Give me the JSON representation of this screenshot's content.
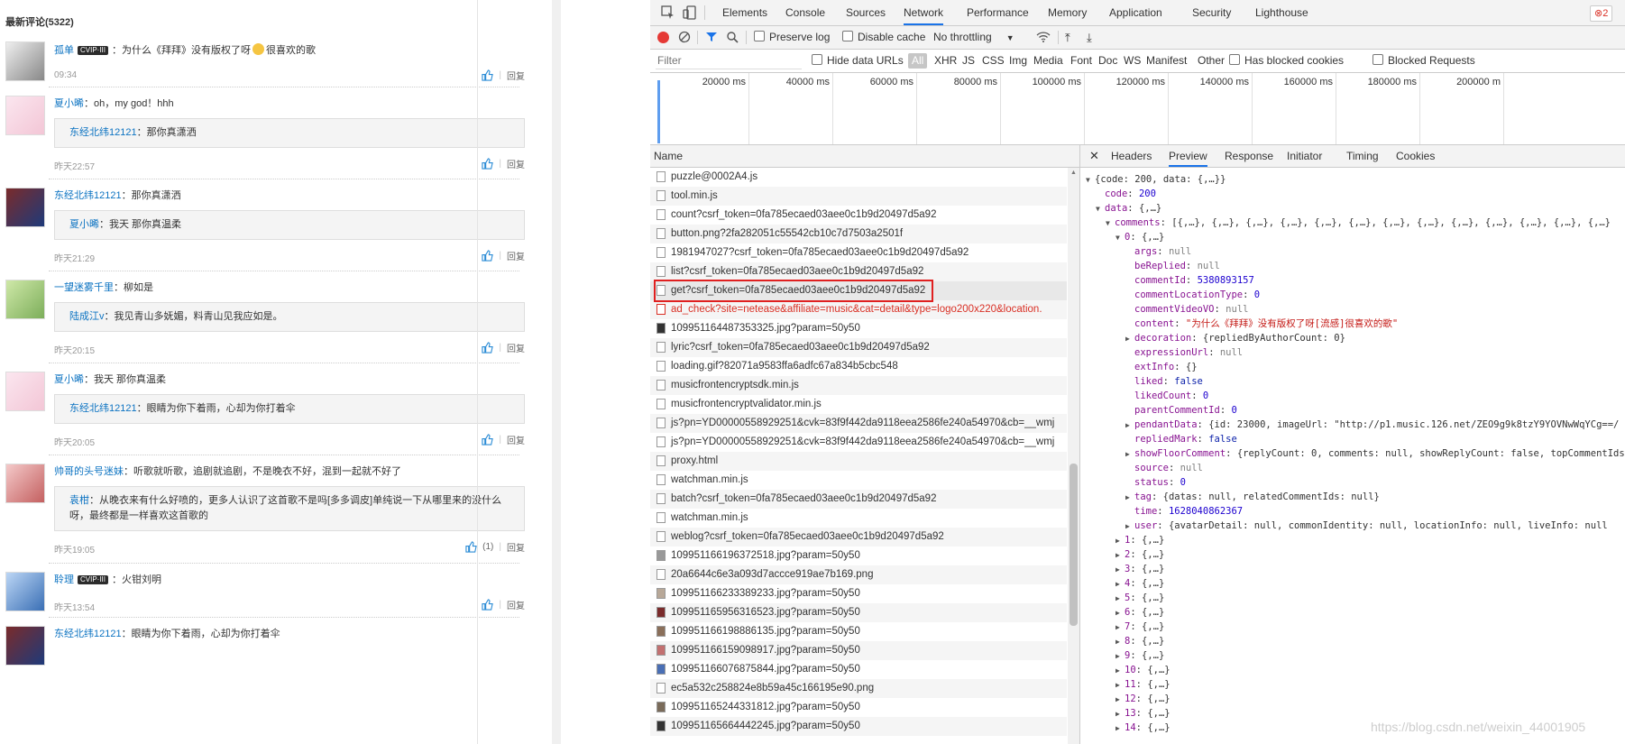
{
  "comments": {
    "header": "最新评论(5322)",
    "items": [
      {
        "user": "孤单",
        "badge": "CVIP·III",
        "text": "：为什么《拜拜》没有版权了呀",
        "text_after": "很喜欢的歌",
        "time": "09:34",
        "like_count": "",
        "reply": "回复"
      },
      {
        "user": "夏小晞",
        "text": "：oh，my god！hhh",
        "quote_user": "东经北纬12121",
        "quote_text": "：那你真潇洒",
        "time": "昨天22:57",
        "like_count": "",
        "reply": "回复"
      },
      {
        "user": "东经北纬12121",
        "text": "：那你真潇洒",
        "quote_user": "夏小晞",
        "quote_text": "：我天 那你真温柔",
        "time": "昨天21:29",
        "like_count": "",
        "reply": "回复"
      },
      {
        "user": "一望迷雾千里",
        "text": "：柳如是",
        "quote_user": "陆成江v",
        "quote_text": "：我见青山多妩媚，料青山见我应如是。",
        "time": "昨天20:15",
        "like_count": "",
        "reply": "回复"
      },
      {
        "user": "夏小晞",
        "text": "：我天 那你真温柔",
        "quote_user": "东经北纬12121",
        "quote_text": "：眼睛为你下着雨，心却为你打着伞",
        "time": "昨天20:05",
        "like_count": "",
        "reply": "回复"
      },
      {
        "user": "帅哥的头号迷妹",
        "text": "：听歌就听歌，追剧就追剧，不是晚衣不好，混到一起就不好了",
        "quote_user": "袁柑",
        "quote_text": "：从晚衣来有什么好喷的，更多人认识了这首歌不是吗[多多调皮]单纯说一下从哪里来的没什么呀，最终都是一样喜欢这首歌的",
        "time": "昨天19:05",
        "like_count": "(1)",
        "reply": "回复"
      },
      {
        "user": "聆理",
        "badge": "CVIP·III",
        "text": "：火钳刘明",
        "time": "昨天13:54",
        "like_count": "",
        "reply": "回复"
      },
      {
        "user": "东经北纬12121",
        "text": "：眼睛为你下着雨，心却为你打着伞",
        "time": "",
        "like_count": "",
        "reply": ""
      }
    ]
  },
  "devtools": {
    "tabs": [
      "Elements",
      "Console",
      "Sources",
      "Network",
      "Performance",
      "Memory",
      "Application",
      "Security",
      "Lighthouse"
    ],
    "active_tab": "Network",
    "error_count": "2",
    "toolbar": {
      "preserve_log": "Preserve log",
      "disable_cache": "Disable cache",
      "throttling": "No throttling"
    },
    "filter": {
      "placeholder": "Filter",
      "hide_data_urls": "Hide data URLs",
      "types": [
        "All",
        "XHR",
        "JS",
        "CSS",
        "Img",
        "Media",
        "Font",
        "Doc",
        "WS",
        "Manifest",
        "Other"
      ],
      "has_blocked": "Has blocked cookies",
      "blocked_requests": "Blocked Requests"
    },
    "overview_labels": [
      "20000 ms",
      "40000 ms",
      "60000 ms",
      "80000 ms",
      "100000 ms",
      "120000 ms",
      "140000 ms",
      "160000 ms",
      "180000 ms",
      "200000 m"
    ],
    "list_header": "Name",
    "requests": [
      "puzzle@0002A4.js",
      "tool.min.js",
      "count?csrf_token=0fa785ecaed03aee0c1b9d20497d5a92",
      "button.png?2fa282051c55542cb10c7d7503a2501f",
      "1981947027?csrf_token=0fa785ecaed03aee0c1b9d20497d5a92",
      "list?csrf_token=0fa785ecaed03aee0c1b9d20497d5a92",
      "get?csrf_token=0fa785ecaed03aee0c1b9d20497d5a92",
      "ad_check?site=netease&affiliate=music&cat=detail&type=logo200x220&location.",
      "109951164487353325.jpg?param=50y50",
      "lyric?csrf_token=0fa785ecaed03aee0c1b9d20497d5a92",
      "loading.gif?82071a9583ffa6adfc67a834b5cbc548",
      "musicfrontencryptsdk.min.js",
      "musicfrontencryptvalidator.min.js",
      "js?pn=YD00000558929251&cvk=83f9f442da9118eea2586fe240a54970&cb=__wmj",
      "js?pn=YD00000558929251&cvk=83f9f442da9118eea2586fe240a54970&cb=__wmj",
      "proxy.html",
      "watchman.min.js",
      "batch?csrf_token=0fa785ecaed03aee0c1b9d20497d5a92",
      "watchman.min.js",
      "weblog?csrf_token=0fa785ecaed03aee0c1b9d20497d5a92",
      "109951166196372518.jpg?param=50y50",
      "20a6644c6e3a093d7accce919ae7b169.png",
      "109951166233389233.jpg?param=50y50",
      "109951165956316523.jpg?param=50y50",
      "109951166198886135.jpg?param=50y50",
      "109951166159098917.jpg?param=50y50",
      "109951166076875844.jpg?param=50y50",
      "ec5a532c258824e8b59a45c166195e90.png",
      "109951165244331812.jpg?param=50y50",
      "109951165664442245.jpg?param=50y50"
    ],
    "selected_request": "get?csrf_token=0fa785ecaed03aee0c1b9d20497d5a92",
    "preview_tabs": [
      "Headers",
      "Preview",
      "Response",
      "Initiator",
      "Timing",
      "Cookies"
    ],
    "active_preview_tab": "Preview",
    "json_tree": [
      {
        "indent": 0,
        "tri": "▼",
        "key": "",
        "val": "{code: 200, data: {,…}}",
        "vt": "p"
      },
      {
        "indent": 1,
        "tri": "",
        "key": "code",
        "val": "200",
        "vt": "n"
      },
      {
        "indent": 1,
        "tri": "▼",
        "key": "data",
        "val": "{,…}",
        "vt": "p"
      },
      {
        "indent": 2,
        "tri": "▼",
        "key": "comments",
        "val": "[{,…}, {,…}, {,…}, {,…}, {,…}, {,…}, {,…}, {,…}, {,…}, {,…}, {,…}, {,…}, {,…}",
        "vt": "p"
      },
      {
        "indent": 3,
        "tri": "▼",
        "key": "0",
        "val": "{,…}",
        "vt": "p"
      },
      {
        "indent": 4,
        "tri": "",
        "key": "args",
        "val": "null",
        "vt": "nl"
      },
      {
        "indent": 4,
        "tri": "",
        "key": "beReplied",
        "val": "null",
        "vt": "nl"
      },
      {
        "indent": 4,
        "tri": "",
        "key": "commentId",
        "val": "5380893157",
        "vt": "n"
      },
      {
        "indent": 4,
        "tri": "",
        "key": "commentLocationType",
        "val": "0",
        "vt": "n"
      },
      {
        "indent": 4,
        "tri": "",
        "key": "commentVideoVO",
        "val": "null",
        "vt": "nl"
      },
      {
        "indent": 4,
        "tri": "",
        "key": "content",
        "val": "\"为什么《拜拜》没有版权了呀[流感]很喜欢的歌\"",
        "vt": "s"
      },
      {
        "indent": 4,
        "tri": "▶",
        "key": "decoration",
        "val": "{repliedByAuthorCount: 0}",
        "vt": "p"
      },
      {
        "indent": 4,
        "tri": "",
        "key": "expressionUrl",
        "val": "null",
        "vt": "nl"
      },
      {
        "indent": 4,
        "tri": "",
        "key": "extInfo",
        "val": "{}",
        "vt": "p"
      },
      {
        "indent": 4,
        "tri": "",
        "key": "liked",
        "val": "false",
        "vt": "b"
      },
      {
        "indent": 4,
        "tri": "",
        "key": "likedCount",
        "val": "0",
        "vt": "n"
      },
      {
        "indent": 4,
        "tri": "",
        "key": "parentCommentId",
        "val": "0",
        "vt": "n"
      },
      {
        "indent": 4,
        "tri": "▶",
        "key": "pendantData",
        "val": "{id: 23000, imageUrl: \"http://p1.music.126.net/ZEO9g9k8tzY9YOVNwWqYCg==/",
        "vt": "p"
      },
      {
        "indent": 4,
        "tri": "",
        "key": "repliedMark",
        "val": "false",
        "vt": "b"
      },
      {
        "indent": 4,
        "tri": "▶",
        "key": "showFloorComment",
        "val": "{replyCount: 0, comments: null, showReplyCount: false, topCommentIds",
        "vt": "p"
      },
      {
        "indent": 4,
        "tri": "",
        "key": "source",
        "val": "null",
        "vt": "nl"
      },
      {
        "indent": 4,
        "tri": "",
        "key": "status",
        "val": "0",
        "vt": "n"
      },
      {
        "indent": 4,
        "tri": "▶",
        "key": "tag",
        "val": "{datas: null, relatedCommentIds: null}",
        "vt": "p"
      },
      {
        "indent": 4,
        "tri": "",
        "key": "time",
        "val": "1628040862367",
        "vt": "n"
      },
      {
        "indent": 4,
        "tri": "▶",
        "key": "user",
        "val": "{avatarDetail: null, commonIdentity: null, locationInfo: null, liveInfo: null",
        "vt": "p"
      },
      {
        "indent": 3,
        "tri": "▶",
        "key": "1",
        "val": "{,…}",
        "vt": "p"
      },
      {
        "indent": 3,
        "tri": "▶",
        "key": "2",
        "val": "{,…}",
        "vt": "p"
      },
      {
        "indent": 3,
        "tri": "▶",
        "key": "3",
        "val": "{,…}",
        "vt": "p"
      },
      {
        "indent": 3,
        "tri": "▶",
        "key": "4",
        "val": "{,…}",
        "vt": "p"
      },
      {
        "indent": 3,
        "tri": "▶",
        "key": "5",
        "val": "{,…}",
        "vt": "p"
      },
      {
        "indent": 3,
        "tri": "▶",
        "key": "6",
        "val": "{,…}",
        "vt": "p"
      },
      {
        "indent": 3,
        "tri": "▶",
        "key": "7",
        "val": "{,…}",
        "vt": "p"
      },
      {
        "indent": 3,
        "tri": "▶",
        "key": "8",
        "val": "{,…}",
        "vt": "p"
      },
      {
        "indent": 3,
        "tri": "▶",
        "key": "9",
        "val": "{,…}",
        "vt": "p"
      },
      {
        "indent": 3,
        "tri": "▶",
        "key": "10",
        "val": "{,…}",
        "vt": "p"
      },
      {
        "indent": 3,
        "tri": "▶",
        "key": "11",
        "val": "{,…}",
        "vt": "p"
      },
      {
        "indent": 3,
        "tri": "▶",
        "key": "12",
        "val": "{,…}",
        "vt": "p"
      },
      {
        "indent": 3,
        "tri": "▶",
        "key": "13",
        "val": "{,…}",
        "vt": "p"
      },
      {
        "indent": 3,
        "tri": "▶",
        "key": "14",
        "val": "{,…}",
        "vt": "p"
      }
    ]
  },
  "watermark": "https://blog.csdn.net/weixin_44001905"
}
